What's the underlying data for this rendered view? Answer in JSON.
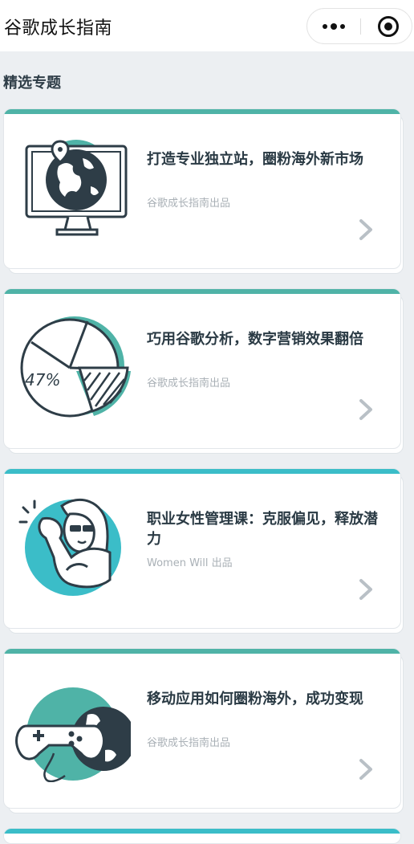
{
  "header": {
    "title": "谷歌成长指南"
  },
  "section": {
    "title": "精选专题"
  },
  "cards": [
    {
      "title": "打造专业独立站，圈粉海外新市场",
      "subtitle": "谷歌成长指南出品",
      "accent": "#4fb3a7"
    },
    {
      "title": "巧用谷歌分析，数字营销效果翻倍",
      "subtitle": "谷歌成长指南出品",
      "accent": "#4fb3a7",
      "pie_label": "47%"
    },
    {
      "title": "职业女性管理课：克服偏见，释放潜力",
      "subtitle": "Women Will 出品",
      "accent": "#3bbdc8"
    },
    {
      "title": "移动应用如何圈粉海外，成功变现",
      "subtitle": "谷歌成长指南出品",
      "accent": "#4fb3a7"
    }
  ],
  "colors": {
    "teal": "#4fb3a7",
    "cyan": "#3bbdc8",
    "ink": "#2e3d47",
    "muted": "#a9b0b6",
    "background": "#eceff2"
  },
  "icons": [
    "more-icon",
    "target-icon",
    "monitor-globe-icon",
    "pie-chart-icon",
    "woman-flex-icon",
    "gamepad-globe-icon",
    "chevron-right-icon"
  ]
}
